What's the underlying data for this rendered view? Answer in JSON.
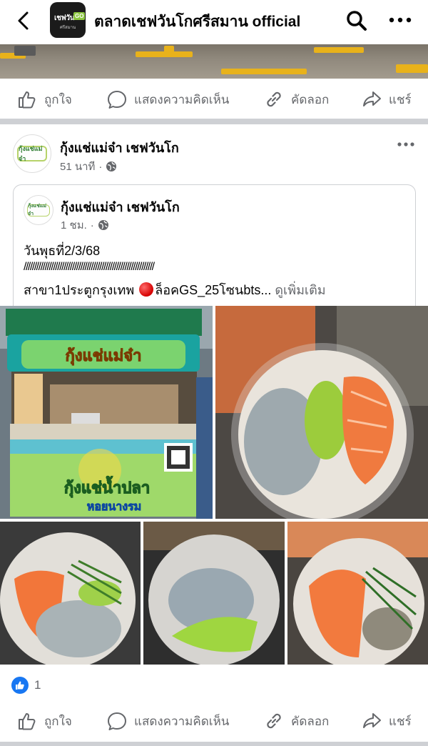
{
  "header": {
    "page_title": "ตลาดเชฟวันโกศรีสมาน official",
    "avatar_text": "เชฟวัน",
    "avatar_badge": "GO",
    "avatar_sub": "ศรีสมาน",
    "back_icon": "back-arrow-icon",
    "search_icon": "search-icon",
    "more_icon": "more-horizontal-icon"
  },
  "action_bar": {
    "like": "ถูกใจ",
    "comment": "แสดงความคิดเห็น",
    "copy": "คัดลอก",
    "share": "แชร์"
  },
  "post": {
    "author": "กุ้งแช่แม่จ๋า เชฟวันโก",
    "time": "51 นาที",
    "logo_text": "กุ้งแช่แม่จ๋า",
    "shared": {
      "author": "กุ้งแช่แม่จ๋า เชฟวันโก",
      "time": "1 ชม.",
      "line1": "วันพุธที่2/3/68",
      "line2": "//////////////////////////////////////////////////////////////",
      "line3_before": "สาขา1ประตูกรุงเทพ ",
      "line3_after": "ล็อคGS_25โซนbts...",
      "see_more": "ดูเพิ่มเติม"
    },
    "photos": {
      "stall_sign_top": "กุ้งแช่แม่จ๋า",
      "stall_sign_bottom": "กุ้งแช่น้ำปลา",
      "stall_sign_bottom2": "หอยนางรม"
    },
    "reaction_count": "1"
  },
  "colors": {
    "primary_blue": "#1877f2",
    "secondary_text": "#65676b",
    "divider": "#ced0d4"
  }
}
